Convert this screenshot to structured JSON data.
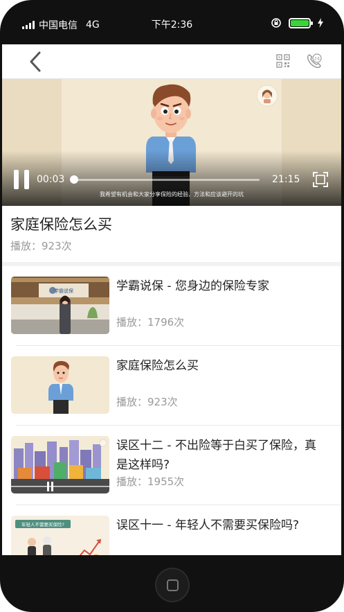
{
  "status_bar": {
    "carrier": "中国电信",
    "network": "4G",
    "time": "下午2:36",
    "battery_color": "#3ad33a"
  },
  "nav": {
    "back_icon": "chevron-left-icon",
    "qr_icon": "qr-code-icon",
    "phone_icon": "phone-24h-icon"
  },
  "player": {
    "current_time": "00:03",
    "total_time": "21:15",
    "progress": 0.002,
    "subtitle": "我希望有机会和大家分享保险的经验、方法和应该避开的坑"
  },
  "now_playing": {
    "title": "家庭保险怎么买",
    "plays": "播放：923次"
  },
  "list": [
    {
      "title": "学霸说保 - 您身边的保险专家",
      "plays": "播放：1796次"
    },
    {
      "title": "家庭保险怎么买",
      "plays": "播放：923次"
    },
    {
      "title": "误区十二 - 不出险等于白买了保险，真是这样吗?",
      "plays": "播放：1955次"
    },
    {
      "title": "误区十一 - 年轻人不需要买保险吗?",
      "plays": ""
    }
  ],
  "thumbs": {
    "office_sign": "学霸说保",
    "elderly_banner": "年轻人不需要买保险?"
  }
}
